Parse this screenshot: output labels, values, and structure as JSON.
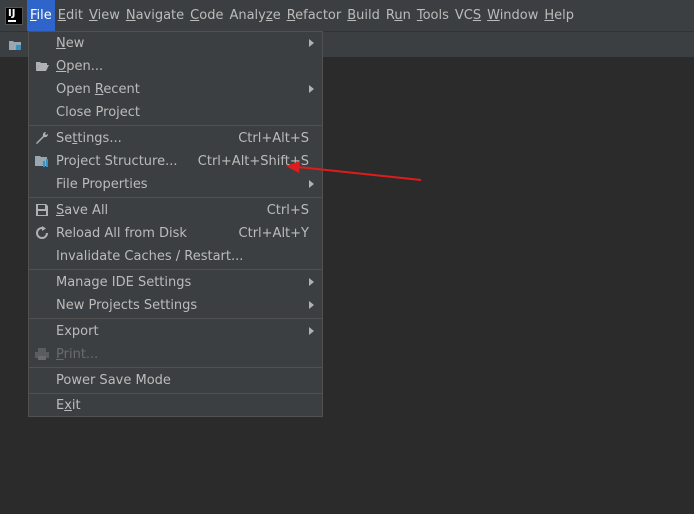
{
  "menubar": {
    "items": [
      {
        "pre": "",
        "mn": "F",
        "post": "ile"
      },
      {
        "pre": "",
        "mn": "E",
        "post": "dit"
      },
      {
        "pre": "",
        "mn": "V",
        "post": "iew"
      },
      {
        "pre": "",
        "mn": "N",
        "post": "avigate"
      },
      {
        "pre": "",
        "mn": "C",
        "post": "ode"
      },
      {
        "pre": "Analy",
        "mn": "z",
        "post": "e"
      },
      {
        "pre": "",
        "mn": "R",
        "post": "efactor"
      },
      {
        "pre": "",
        "mn": "B",
        "post": "uild"
      },
      {
        "pre": "R",
        "mn": "u",
        "post": "n"
      },
      {
        "pre": "",
        "mn": "T",
        "post": "ools"
      },
      {
        "pre": "VC",
        "mn": "S",
        "post": ""
      },
      {
        "pre": "",
        "mn": "W",
        "post": "indow"
      },
      {
        "pre": "",
        "mn": "H",
        "post": "elp"
      }
    ]
  },
  "file_menu": {
    "items": [
      {
        "pre": "",
        "mn": "N",
        "post": "ew",
        "shortcut": ""
      },
      {
        "pre": "",
        "mn": "O",
        "post": "pen...",
        "shortcut": ""
      },
      {
        "pre": "Open ",
        "mn": "R",
        "post": "ecent",
        "shortcut": ""
      },
      {
        "pre": "Close Project",
        "mn": "",
        "post": "",
        "shortcut": ""
      },
      {
        "pre": "Se",
        "mn": "t",
        "post": "tings...",
        "shortcut": "Ctrl+Alt+S"
      },
      {
        "pre": "Project Structure...",
        "mn": "",
        "post": "",
        "shortcut": "Ctrl+Alt+Shift+S"
      },
      {
        "pre": "File Properties",
        "mn": "",
        "post": "",
        "shortcut": ""
      },
      {
        "pre": "",
        "mn": "S",
        "post": "ave All",
        "shortcut": "Ctrl+S"
      },
      {
        "pre": "Reload All from Disk",
        "mn": "",
        "post": "",
        "shortcut": "Ctrl+Alt+Y"
      },
      {
        "pre": "Invalidate Caches / Restart...",
        "mn": "",
        "post": "",
        "shortcut": ""
      },
      {
        "pre": "Manage IDE Settings",
        "mn": "",
        "post": "",
        "shortcut": ""
      },
      {
        "pre": "New Projects Settings",
        "mn": "",
        "post": "",
        "shortcut": ""
      },
      {
        "pre": "Export",
        "mn": "",
        "post": "",
        "shortcut": ""
      },
      {
        "pre": "",
        "mn": "P",
        "post": "rint...",
        "shortcut": ""
      },
      {
        "pre": "Power Save Mode",
        "mn": "",
        "post": "",
        "shortcut": ""
      },
      {
        "pre": "E",
        "mn": "x",
        "post": "it",
        "shortcut": ""
      }
    ]
  },
  "colors": {
    "menubar_bg": "#3c3f41",
    "active_menu": "#2f65ca",
    "editor_bg": "#2b2b2b",
    "annotation_arrow": "#e01b1b"
  }
}
